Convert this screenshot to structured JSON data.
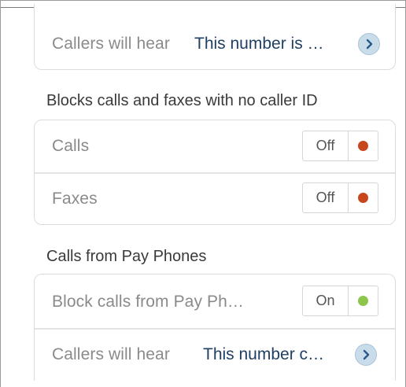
{
  "top_card": {
    "label": "Callers will hear",
    "value": "This number is …"
  },
  "no_caller_id": {
    "header": "Blocks calls and faxes with no caller ID",
    "rows": [
      {
        "label": "Calls",
        "state": "Off",
        "color": "#c8461b"
      },
      {
        "label": "Faxes",
        "state": "Off",
        "color": "#c8461b"
      }
    ]
  },
  "pay_phones": {
    "header": "Calls from Pay Phones",
    "block_row": {
      "label": "Block calls from Pay Ph…",
      "state": "On",
      "color": "#8cc64b"
    },
    "callers_row": {
      "label": "Callers will hear",
      "value": "This number c…"
    }
  },
  "icons": {
    "chevron": "chevron-right-icon",
    "status_dot": "status-dot-icon"
  }
}
